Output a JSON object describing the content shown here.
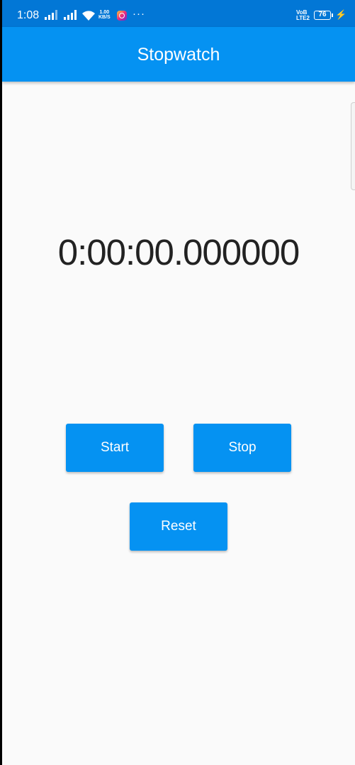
{
  "status_bar": {
    "time": "1:08",
    "net_speed_value": "1.00",
    "net_speed_unit": "KB/S",
    "more_indicator": "···",
    "volte_line1": "VoB",
    "volte_line2": "LTE2",
    "battery": "76",
    "icons": [
      "signal-icon",
      "signal-icon",
      "wifi-icon",
      "instagram-icon",
      "charging-icon"
    ]
  },
  "app_bar": {
    "title": "Stopwatch",
    "color": "#0592f2"
  },
  "timer": {
    "display": "0:00:00.000000"
  },
  "buttons": {
    "start": "Start",
    "stop": "Stop",
    "reset": "Reset"
  }
}
